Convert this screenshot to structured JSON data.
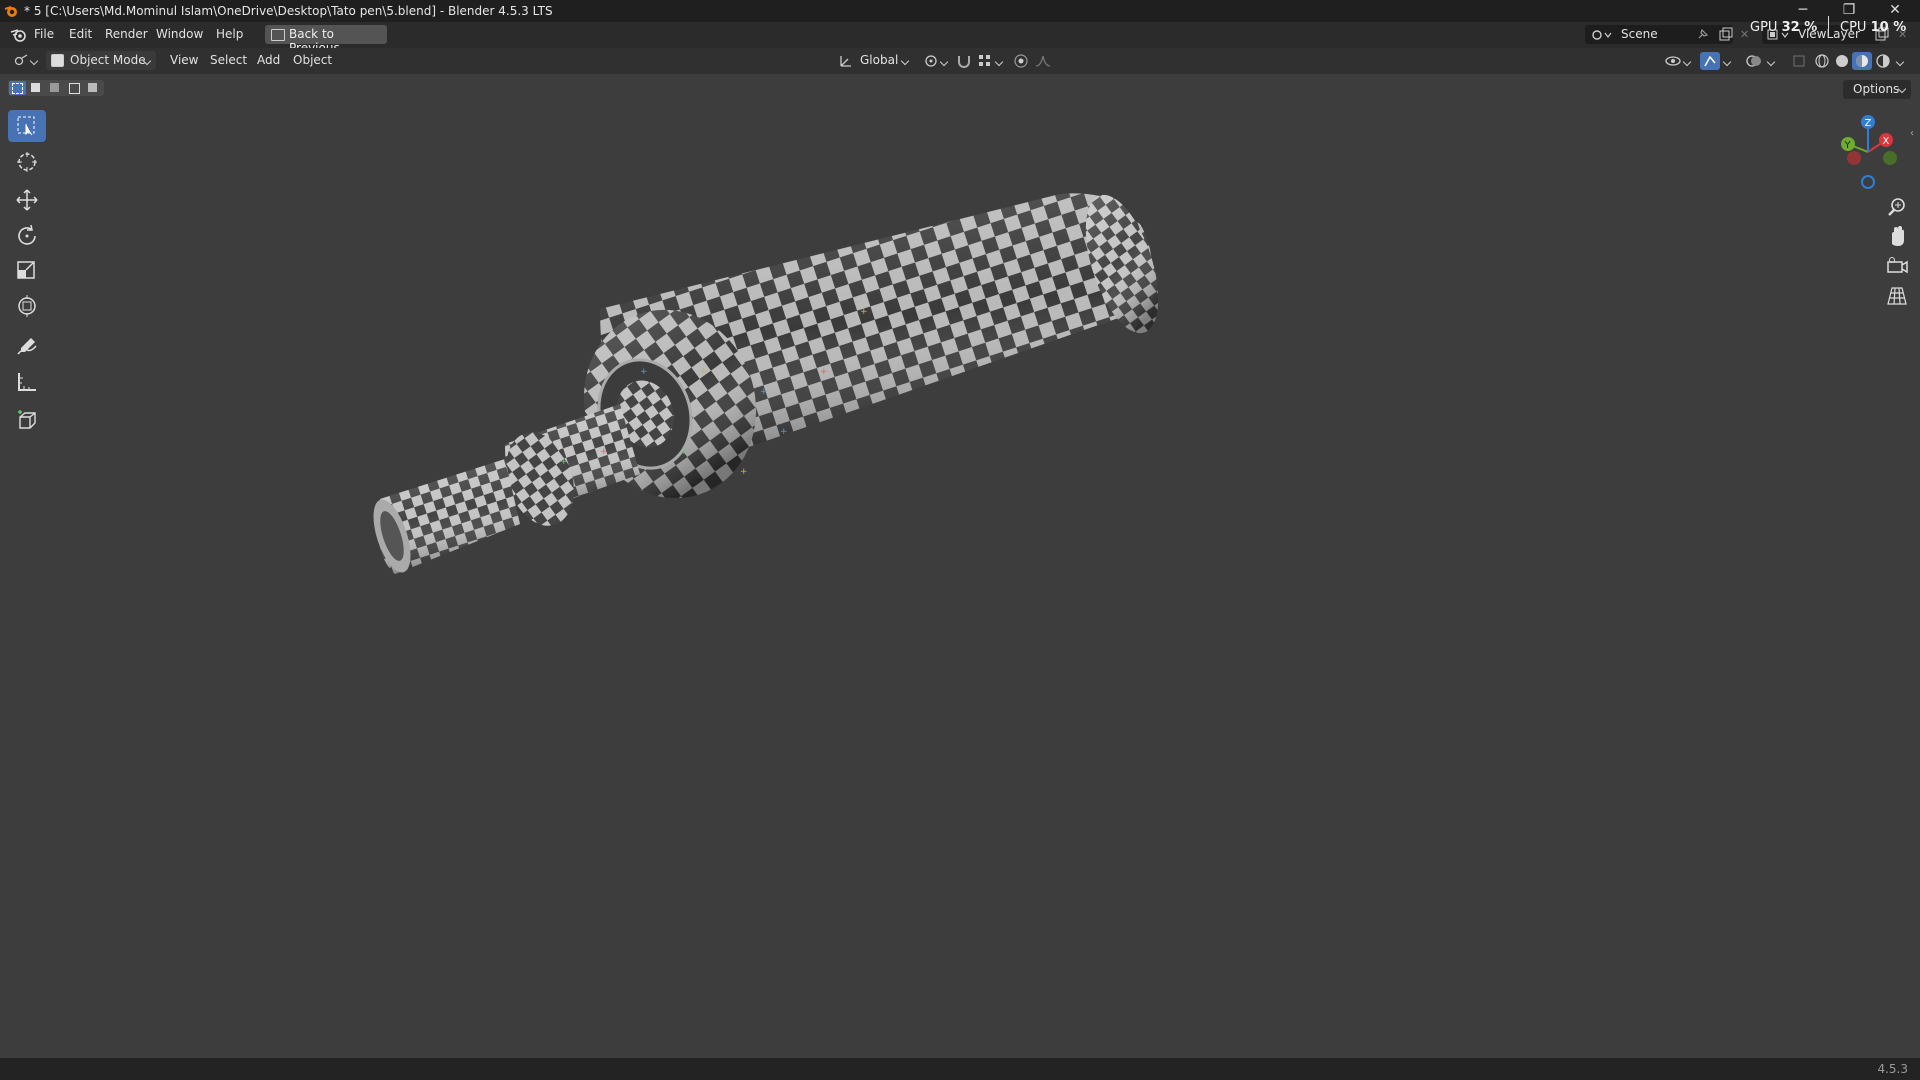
{
  "window": {
    "title": "* 5 [C:\\Users\\Md.Mominul Islam\\OneDrive\\Desktop\\Tato pen\\5.blend] - Blender 4.5.3 LTS"
  },
  "menubar": {
    "items": [
      "File",
      "Edit",
      "Render",
      "Window",
      "Help"
    ],
    "back_button": "Back to Previous",
    "scene": "Scene",
    "view_layer": "ViewLayer"
  },
  "stats": {
    "gpu_label": "GPU",
    "gpu_value": "32 %",
    "cpu_label": "CPU",
    "cpu_value": "10 %"
  },
  "header": {
    "mode": "Object Mode",
    "menus": [
      "View",
      "Select",
      "Add",
      "Object"
    ],
    "orientation": "Global"
  },
  "viewport": {
    "options_label": "Options",
    "gizmo": {
      "x": "X",
      "y": "Y",
      "z": "Z"
    }
  },
  "status": {
    "version": "4.5.3"
  },
  "colors": {
    "accent": "#4772b3",
    "axis_x": "#d9363e",
    "axis_y": "#6dab32",
    "axis_z": "#2f7ed6"
  }
}
